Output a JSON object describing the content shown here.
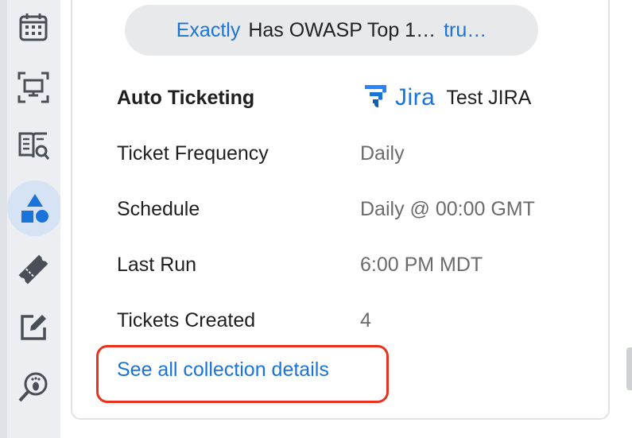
{
  "sidebar": {
    "items": [
      {
        "icon": "calendar-icon"
      },
      {
        "icon": "monitor-scan-icon"
      },
      {
        "icon": "book-search-icon"
      },
      {
        "icon": "shapes-icon",
        "active": true
      },
      {
        "icon": "ticket-icon"
      },
      {
        "icon": "edit-icon"
      },
      {
        "icon": "footprint-search-icon"
      }
    ],
    "active_color": "#1a73d9",
    "icon_color": "#4a4f57"
  },
  "filter": {
    "operator": "Exactly",
    "text": "Has OWASP Top 1…",
    "value": "tru…"
  },
  "details": {
    "auto_ticketing": {
      "label": "Auto Ticketing",
      "integration_logo": "jira-icon",
      "integration_word": "Jira",
      "integration_name": "Test JIRA"
    },
    "rows": [
      {
        "label": "Ticket Frequency",
        "value": "Daily"
      },
      {
        "label": "Schedule",
        "value": "Daily @ 00:00 GMT"
      },
      {
        "label": "Last Run",
        "value": "6:00 PM MDT"
      },
      {
        "label": "Tickets Created",
        "value": "4"
      }
    ],
    "link": "See all collection details"
  },
  "colors": {
    "link": "#1a73d9",
    "highlight": "#e8321f"
  }
}
